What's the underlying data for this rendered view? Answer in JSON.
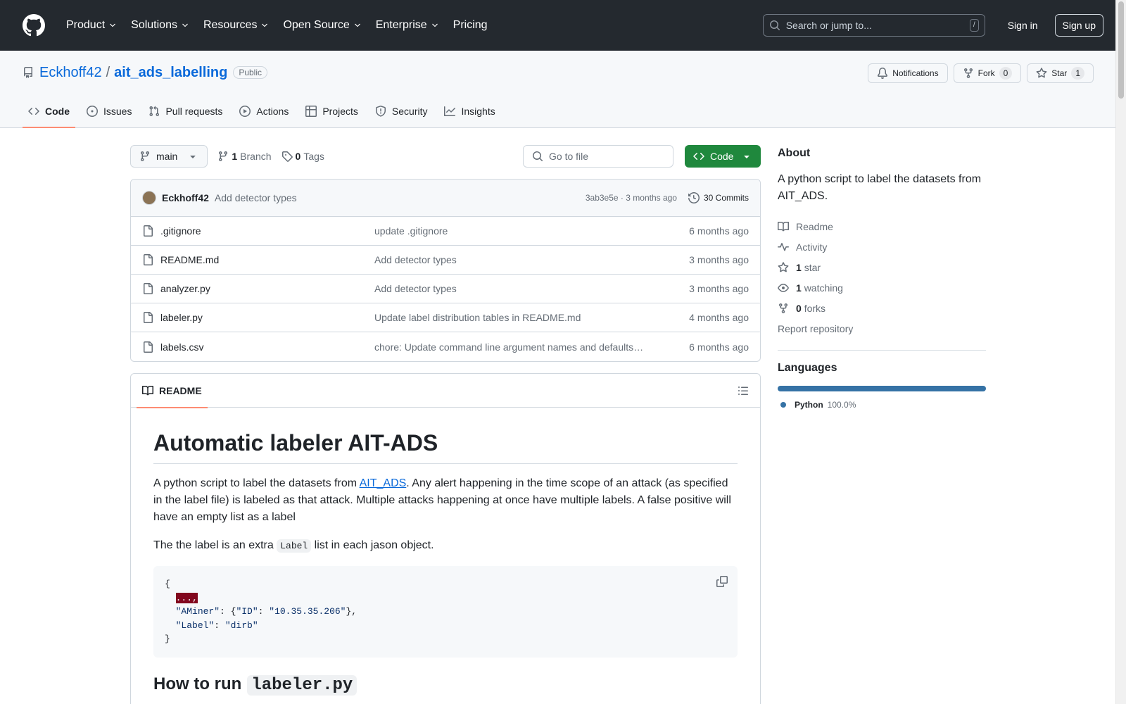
{
  "header": {
    "nav": [
      {
        "label": "Product",
        "dropdown": true
      },
      {
        "label": "Solutions",
        "dropdown": true
      },
      {
        "label": "Resources",
        "dropdown": true
      },
      {
        "label": "Open Source",
        "dropdown": true
      },
      {
        "label": "Enterprise",
        "dropdown": true
      },
      {
        "label": "Pricing",
        "dropdown": false
      }
    ],
    "search_placeholder": "Search or jump to...",
    "search_shortcut": "/",
    "sign_in": "Sign in",
    "sign_up": "Sign up"
  },
  "repo": {
    "owner": "Eckhoff42",
    "separator": "/",
    "name": "ait_ads_labelling",
    "visibility": "Public",
    "notifications_label": "Notifications",
    "fork_label": "Fork",
    "fork_count": "0",
    "star_label": "Star",
    "star_count": "1"
  },
  "tabs": [
    {
      "label": "Code",
      "icon": "code-icon",
      "active": true
    },
    {
      "label": "Issues",
      "icon": "issue-icon",
      "active": false
    },
    {
      "label": "Pull requests",
      "icon": "pull-request-icon",
      "active": false
    },
    {
      "label": "Actions",
      "icon": "play-icon",
      "active": false
    },
    {
      "label": "Projects",
      "icon": "table-icon",
      "active": false
    },
    {
      "label": "Security",
      "icon": "shield-icon",
      "active": false
    },
    {
      "label": "Insights",
      "icon": "graph-icon",
      "active": false
    }
  ],
  "filebar": {
    "branch": "main",
    "branch_count": "1",
    "branch_label": "Branch",
    "tag_count": "0",
    "tag_label": "Tags",
    "goto_placeholder": "Go to file",
    "code_button": "Code"
  },
  "latest_commit": {
    "author": "Eckhoff42",
    "message": "Add detector types",
    "hash": "3ab3e5e",
    "separator": "·",
    "time": "3 months ago",
    "commits_label": "30 Commits"
  },
  "files": [
    {
      "name": ".gitignore",
      "message": "update .gitignore",
      "date": "6 months ago"
    },
    {
      "name": "README.md",
      "message": "Add detector types",
      "date": "3 months ago"
    },
    {
      "name": "analyzer.py",
      "message": "Add detector types",
      "date": "3 months ago"
    },
    {
      "name": "labeler.py",
      "message": "Update label distribution tables in README.md",
      "date": "4 months ago"
    },
    {
      "name": "labels.csv",
      "message": "chore: Update command line argument names and defaults…",
      "date": "6 months ago"
    }
  ],
  "readme": {
    "tab_label": "README",
    "title": "Automatic labeler AIT-ADS",
    "p1_before": "A python script to label the datasets from ",
    "p1_link": "AIT_ADS",
    "p1_after": ". Any alert happening in the time scope of an attack (as specified in the label file) is labeled as that attack. Multiple attacks happening at once have multiple labels. A false positive will have an empty list as a label",
    "p2_before": "The the label is an extra ",
    "p2_code": "Label",
    "p2_after": " list in each jason object.",
    "code": {
      "open": "{",
      "ellipsis": "...,",
      "line2_key": "\"AMiner\"",
      "line2_mid": ": {",
      "line2_inner_key": "\"ID\"",
      "line2_colon": ": ",
      "line2_inner_val": "\"10.35.35.206\"",
      "line2_end": "},",
      "line3_key": "\"Label\"",
      "line3_colon": ": ",
      "line3_val": "\"dirb\"",
      "close": "}"
    },
    "h2_text": "How to run",
    "h2_code": "labeler.py"
  },
  "about": {
    "title": "About",
    "description": "A python script to label the datasets from AIT_ADS.",
    "readme": "Readme",
    "activity": "Activity",
    "stars_count": "1",
    "stars_label": "star",
    "watching_count": "1",
    "watching_label": "watching",
    "forks_count": "0",
    "forks_label": "forks",
    "report": "Report repository"
  },
  "languages": {
    "title": "Languages",
    "items": [
      {
        "name": "Python",
        "percent": "100.0%",
        "color": "#3572A5"
      }
    ]
  },
  "colors": {
    "header_bg": "#24292f",
    "link": "#0969da",
    "primary_button": "#1f883d",
    "tab_underline": "#fd8c73"
  }
}
